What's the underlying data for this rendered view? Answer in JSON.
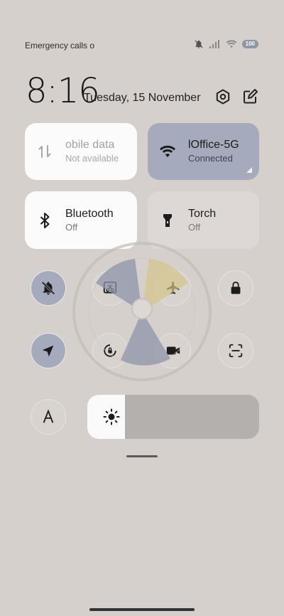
{
  "status_bar": {
    "left_text": "Emergency calls o",
    "battery": "100",
    "icons": [
      "mute-icon",
      "signal-icon",
      "wifi-icon",
      "battery-icon"
    ]
  },
  "header": {
    "time": "8:16",
    "date": "Tuesday, 15 November",
    "icons": [
      "settings-icon",
      "edit-icon"
    ]
  },
  "tiles": {
    "mobile_data": {
      "title": "obile data",
      "subtitle": "Not available",
      "icon": "mobile-data-icon"
    },
    "wifi": {
      "title": "lOffice-5G",
      "subtitle": "Connected",
      "icon": "wifi-icon"
    },
    "bluetooth": {
      "title": "Bluetooth",
      "subtitle": "Off",
      "icon": "bluetooth-icon"
    },
    "torch": {
      "title": "Torch",
      "subtitle": "Off",
      "icon": "torch-icon"
    }
  },
  "toggles": [
    {
      "name": "silent",
      "icon": "bell-off-icon",
      "state": "on"
    },
    {
      "name": "screenshot",
      "icon": "screenshot-icon",
      "state": "off"
    },
    {
      "name": "airplane-mode",
      "icon": "airplane-icon",
      "state": "off"
    },
    {
      "name": "lock-screen",
      "icon": "lock-icon",
      "state": "off"
    },
    {
      "name": "location",
      "icon": "location-icon",
      "state": "on"
    },
    {
      "name": "rotation-lock",
      "icon": "rotation-lock-icon",
      "state": "off"
    },
    {
      "name": "screen-recorder",
      "icon": "video-icon",
      "state": "off"
    },
    {
      "name": "scanner",
      "icon": "scan-icon",
      "state": "off"
    },
    {
      "name": "auto-brightness",
      "icon": "auto-brightness-icon",
      "state": "off"
    }
  ],
  "brightness": {
    "level": 0.22,
    "icon": "sun-icon"
  },
  "colors": {
    "background": "#d6d0cd",
    "active_accent": "#a5abbc",
    "tile_white": "#fbfbfb",
    "brightness_track": "#b3b0ae"
  }
}
